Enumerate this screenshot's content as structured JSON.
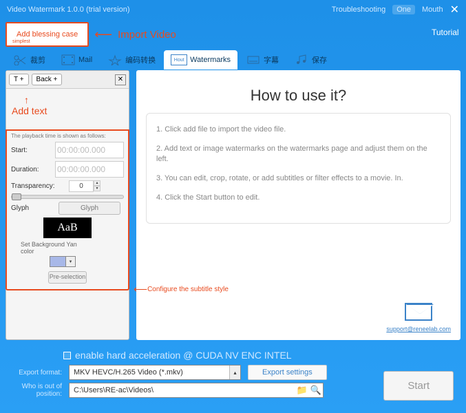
{
  "titlebar": {
    "app_title": "Video Watermark 1.0.0 (trial version)",
    "troubleshoot": "Troubleshooting",
    "one": "One",
    "mouth": "Mouth"
  },
  "toolbar": {
    "add_file": "Add blessing case",
    "add_file_sub": "simplest",
    "import_video": "Import Video",
    "tutorial": "Tutorial"
  },
  "tabs": {
    "t0": "裁剪",
    "t1": "Mail",
    "t2": "编码转换",
    "t3": "Watermarks",
    "t3_badge": "Hout",
    "t4": "字幕",
    "t5": "保存"
  },
  "left": {
    "btn_t": "T +",
    "btn_back": "Back +",
    "add_text": "Add text",
    "hint": "The playback time is shown as follows:",
    "start": "Start:",
    "start_val": "00:00:00.000",
    "duration": "Duration:",
    "duration_val": "00:00:00.000",
    "transparency": "Transparency:",
    "trans_val": "0",
    "glyph_lbl": "Glyph",
    "glyph_btn": "Glyph",
    "preview": "AaB",
    "bgcolor": "Set Background Yan color",
    "preselect": "Pre-selection"
  },
  "right": {
    "title": "How to use it?",
    "s1": "1. Click add file to import the video file.",
    "s2": "2. Add text or image watermarks on the watermarks page and adjust them on the left.",
    "s3": "3. You can edit, crop, rotate, or add subtitles or filter effects to a movie. In.",
    "s4": "4. Click the Start button to edit.",
    "support_email": "support@reneelab.com"
  },
  "config_subtitle": "Configure the subtitle style",
  "bottom": {
    "hwaccel": "enable hard acceleration @ CUDA NV ENC INTEL",
    "export_fmt": "Export format:",
    "format_val": "MKV HEVC/H.265 Video (*.mkv)",
    "export_settings": "Export settings",
    "out_pos": "Who is out of position:",
    "path_val": "C:\\Users\\RE-ac\\Videos\\",
    "start": "Start"
  }
}
